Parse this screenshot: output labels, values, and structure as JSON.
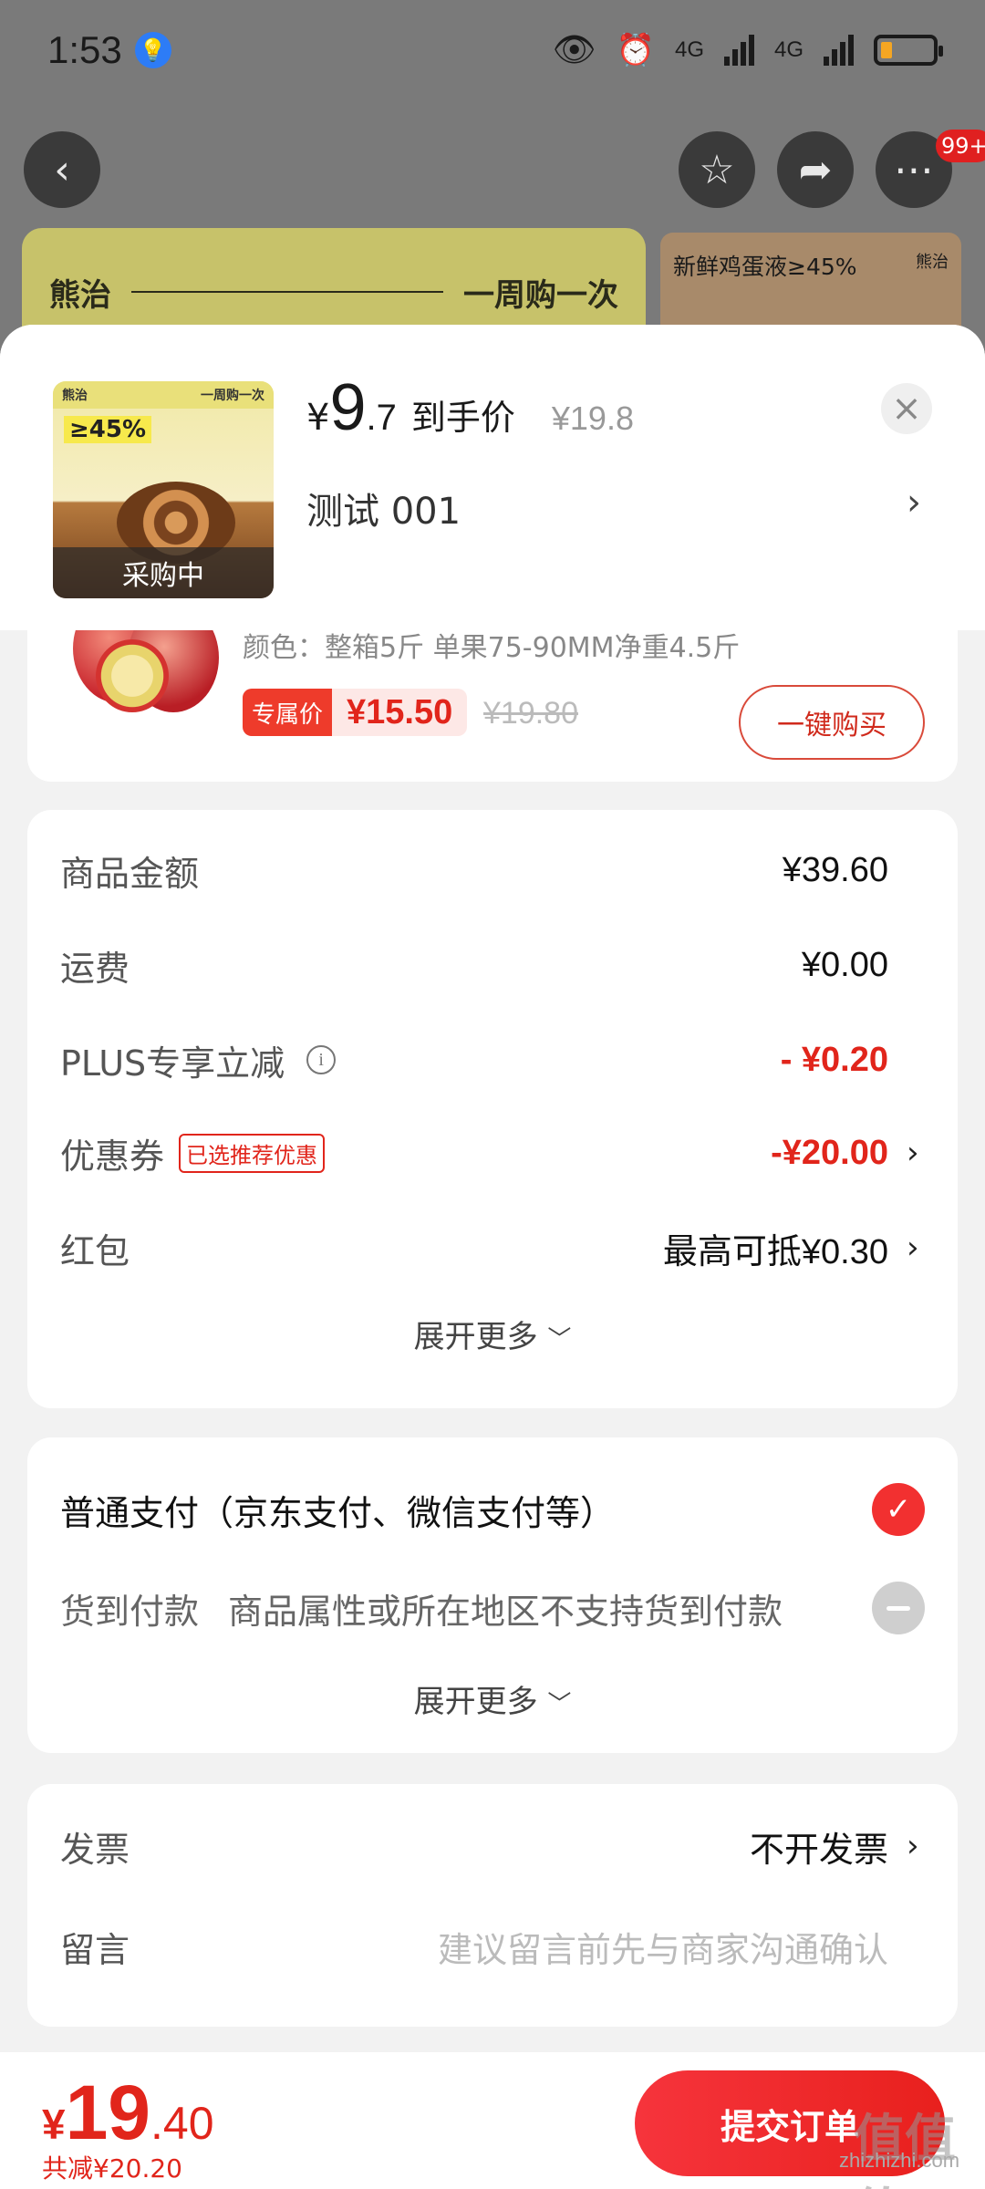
{
  "status_bar": {
    "time": "1:53",
    "network1": "4G",
    "network2": "4G"
  },
  "nav": {
    "back_icon": "chevron-left-icon",
    "badge": "99+"
  },
  "banner": {
    "brand": "熊治",
    "slogan": "一周购一次",
    "right_text": "新鲜鸡蛋液≥45%",
    "right_brand": "熊治"
  },
  "product": {
    "thumb_brand": "熊治",
    "thumb_slogan": "一周购一次",
    "thumb_pct": "≥45%",
    "status": "采购中",
    "currency": "¥",
    "price_int": "9",
    "price_dec": ".7",
    "price_label": "到手价",
    "original_price": "¥19.8",
    "spec": "测试  001"
  },
  "recommend": {
    "variant": "颜色：整箱5斤 单果75-90MM净重4.5斤",
    "tag": "专属价",
    "price": "¥15.50",
    "strike_price": "¥19.80",
    "buy_label": "一键购买"
  },
  "summary": {
    "rows": [
      {
        "label": "商品金额",
        "value": "¥39.60"
      },
      {
        "label": "运费",
        "value": "¥0.00"
      },
      {
        "label": "PLUS专享立减",
        "value": "- ¥0.20"
      },
      {
        "label": "优惠券",
        "tag": "已选推荐优惠",
        "value": "-¥20.00"
      },
      {
        "label": "红包",
        "value": "最高可抵¥0.30"
      }
    ],
    "more": "展开更多"
  },
  "payment": {
    "normal_label": "普通支付（京东支付、微信支付等）",
    "cod_label": "货到付款",
    "cod_note": "商品属性或所在地区不支持货到付款",
    "more": "展开更多"
  },
  "extra": {
    "invoice_label": "发票",
    "invoice_value": "不开发票",
    "note_label": "留言",
    "note_placeholder": "建议留言前先与商家沟通确认"
  },
  "footer": {
    "currency": "¥",
    "total_int": "19",
    "total_dec": ".40",
    "saved": "共减¥20.20",
    "submit_label": "提交订单",
    "watermark": "zhizhizhi.com",
    "watermark_big": "值值值"
  },
  "colors": {
    "accent": "#e1251b",
    "check": "#f23030"
  }
}
